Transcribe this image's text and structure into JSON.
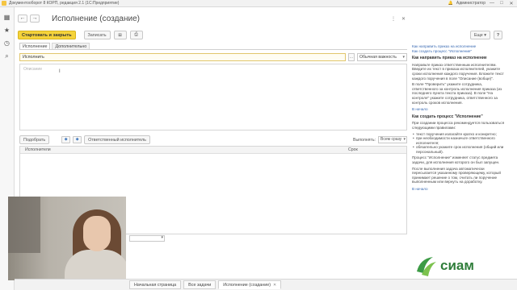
{
  "window": {
    "title": "Документооборот 8 КОРП, редакция 2.1 (1С:Предприятие)",
    "user": "Администратор",
    "controls": [
      "—",
      "□",
      "✕"
    ]
  },
  "form": {
    "title": "Исполнение (создание)",
    "back": "←",
    "forward": "→",
    "header_icons": [
      "⋮",
      "✕"
    ]
  },
  "toolbar": {
    "start_close": "Стартовать и закрыть",
    "save": "Записать",
    "icon1": "⊞",
    "icon2": "⎙",
    "more": "Еще ▾",
    "help": "?"
  },
  "tabs": [
    "Исполнение",
    "Дополнительно"
  ],
  "task_field": {
    "value": "Исполнить",
    "dots": "...",
    "importance": "Обычная важность",
    "arrow": "▾"
  },
  "description": {
    "placeholder": "Описание"
  },
  "executors": {
    "pick": "Подобрать",
    "up": "◆",
    "down": "◆",
    "responsible": "Ответственный исполнитель",
    "mode_label": "Выполнять:",
    "mode_value": "Всем сразу",
    "col_executors": "Исполнители",
    "col_deadline": "Срок"
  },
  "help_panel": {
    "links": [
      "Как направить приказ на исполнение",
      "Как создать процесс \"Исполнение\""
    ],
    "h1": "Как направить приказ на исполнение",
    "p1": "Направьте приказ ответственным исполнителям. Введите их текст в приказа исполнителей, укажите сроки исполнения каждого поручения. Вложите текст каждого поручения в поле \"Описание (вобще)\".",
    "p2": "В поле \"Проверить\" укажите сотрудника, ответственного за контроль исполнения приказа (из последнего пункта текста приказа). В поле \"На контроле\" укажите сотрудника, ответственного за контроль сроков исполнения.",
    "to_top1": "В начало",
    "h2": "Как создать процесс \"Исполнение\"",
    "p3": "При создании процесса рекомендуется пользоваться следующими правилами:",
    "bullets": [
      "текст поручения излагайте кратко и конкретно;",
      "при необходимости назначьте ответственного исполнителя;",
      "обязательно укажите срок исполнения (общий или персональный)."
    ],
    "p4": "Процесс \"Исполнение\" изменяет статус предмета задачи, для исполнения которого он был запущен.",
    "p5": "После выполнения задача автоматически пересылается указанному проверяющему, который принимает решение о том, считать ли поручение выполненным или вернуть на доработку.",
    "to_top2": "В начало"
  },
  "logo": {
    "text": "сиам"
  },
  "taskbar": {
    "tabs": [
      "Начальная страница",
      "Все задачи",
      "Исполнение (создание)"
    ],
    "close": "✕"
  },
  "colors": {
    "primary_button": "#f5d33b",
    "link": "#3b6bb3",
    "logo_green": "#2f7d3a"
  }
}
